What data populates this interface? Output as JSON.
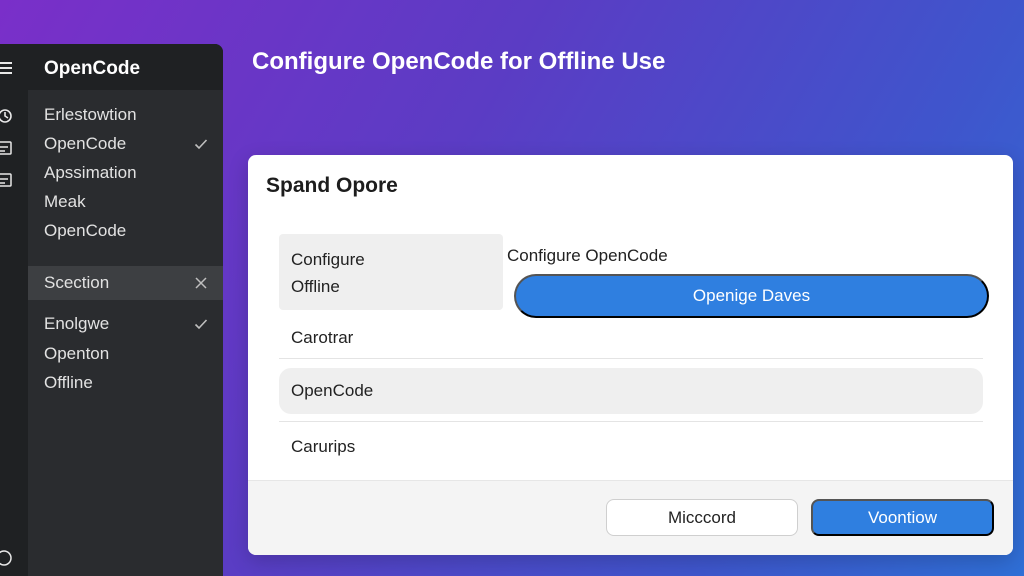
{
  "app": {
    "title": "OpenCode"
  },
  "sidebar": {
    "items": [
      {
        "label": "Erlestowtion",
        "mark": ""
      },
      {
        "label": "OpenCode",
        "mark": "check"
      },
      {
        "label": "Apssimation",
        "mark": ""
      },
      {
        "label": "Meak",
        "mark": ""
      },
      {
        "label": "OpenCode",
        "mark": ""
      },
      {
        "label": "Scection",
        "mark": "close",
        "selected": true
      },
      {
        "label": "Enolgwe",
        "mark": "check"
      },
      {
        "label": "Openton",
        "mark": ""
      },
      {
        "label": "Offline",
        "mark": ""
      }
    ]
  },
  "main": {
    "title": "Configure OpenCode for Offline Use"
  },
  "dialog": {
    "title": "Spand Opore",
    "option_box": {
      "line1": "Configure",
      "line2": "Offline"
    },
    "side_label": "Configure OpenCode",
    "primary_wide_button": "Openige Daves",
    "rows": [
      "Carotrar",
      "OpenCode",
      "Carurips"
    ],
    "footer": {
      "secondary_button": "Micccord",
      "primary_button": "Voontiow"
    }
  },
  "colors": {
    "accent": "#2f7fe0",
    "sidebar_bg": "#2a2c2f",
    "selected_bg": "#3d3f42"
  },
  "icons": {
    "rail": [
      "hamburger-menu-icon",
      "history-icon",
      "list-icon",
      "list-icon",
      "help-icon"
    ]
  }
}
